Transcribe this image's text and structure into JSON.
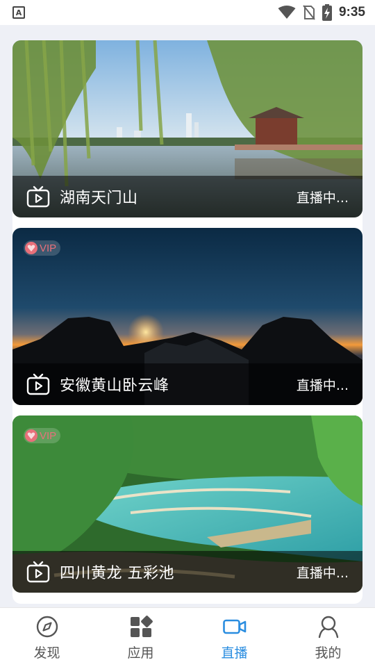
{
  "status_bar": {
    "time": "9:35",
    "left_icon_letter": "A",
    "icons": [
      "wifi-icon",
      "no-sim-icon",
      "battery-charging-icon"
    ]
  },
  "feed": {
    "cards": [
      {
        "title": "湖南天门山",
        "status": "直播中...",
        "vip": false,
        "vip_label": ""
      },
      {
        "title": "安徽黄山卧云峰",
        "status": "直播中...",
        "vip": true,
        "vip_label": "VIP"
      },
      {
        "title": "四川黄龙 五彩池",
        "status": "直播中...",
        "vip": true,
        "vip_label": "VIP"
      }
    ]
  },
  "bottom_nav": {
    "items": [
      {
        "label": "发现",
        "icon": "compass-icon",
        "active": false
      },
      {
        "label": "应用",
        "icon": "apps-grid-icon",
        "active": false
      },
      {
        "label": "直播",
        "icon": "video-camera-icon",
        "active": true
      },
      {
        "label": "我的",
        "icon": "user-icon",
        "active": false
      }
    ]
  },
  "colors": {
    "accent": "#2a8de0",
    "vip": "#e8707a",
    "background": "#eef0f6"
  }
}
